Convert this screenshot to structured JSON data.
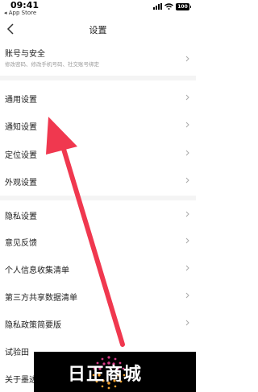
{
  "status_bar": {
    "time": "09:41",
    "back_app": "◂ App Store",
    "battery": "100"
  },
  "header": {
    "title": "设置"
  },
  "account": {
    "title": "账号与安全",
    "subtitle": "修改密码、修改手机号码、社交账号绑定"
  },
  "rows": [
    {
      "label": "通用设置"
    },
    {
      "label": "通知设置"
    },
    {
      "label": "定位设置"
    },
    {
      "label": "外观设置"
    },
    {
      "label": "隐私设置"
    },
    {
      "label": "意见反馈"
    },
    {
      "label": "个人信息收集清单"
    },
    {
      "label": "第三方共享数据清单"
    },
    {
      "label": "隐私政策简要版"
    },
    {
      "label": "试验田"
    },
    {
      "label": "关于墨迹"
    }
  ],
  "watermark": {
    "text": "日正商城"
  },
  "colors": {
    "arrow": "#f0384f",
    "divider": "#f4f4f4",
    "secondary_text": "#999999"
  }
}
